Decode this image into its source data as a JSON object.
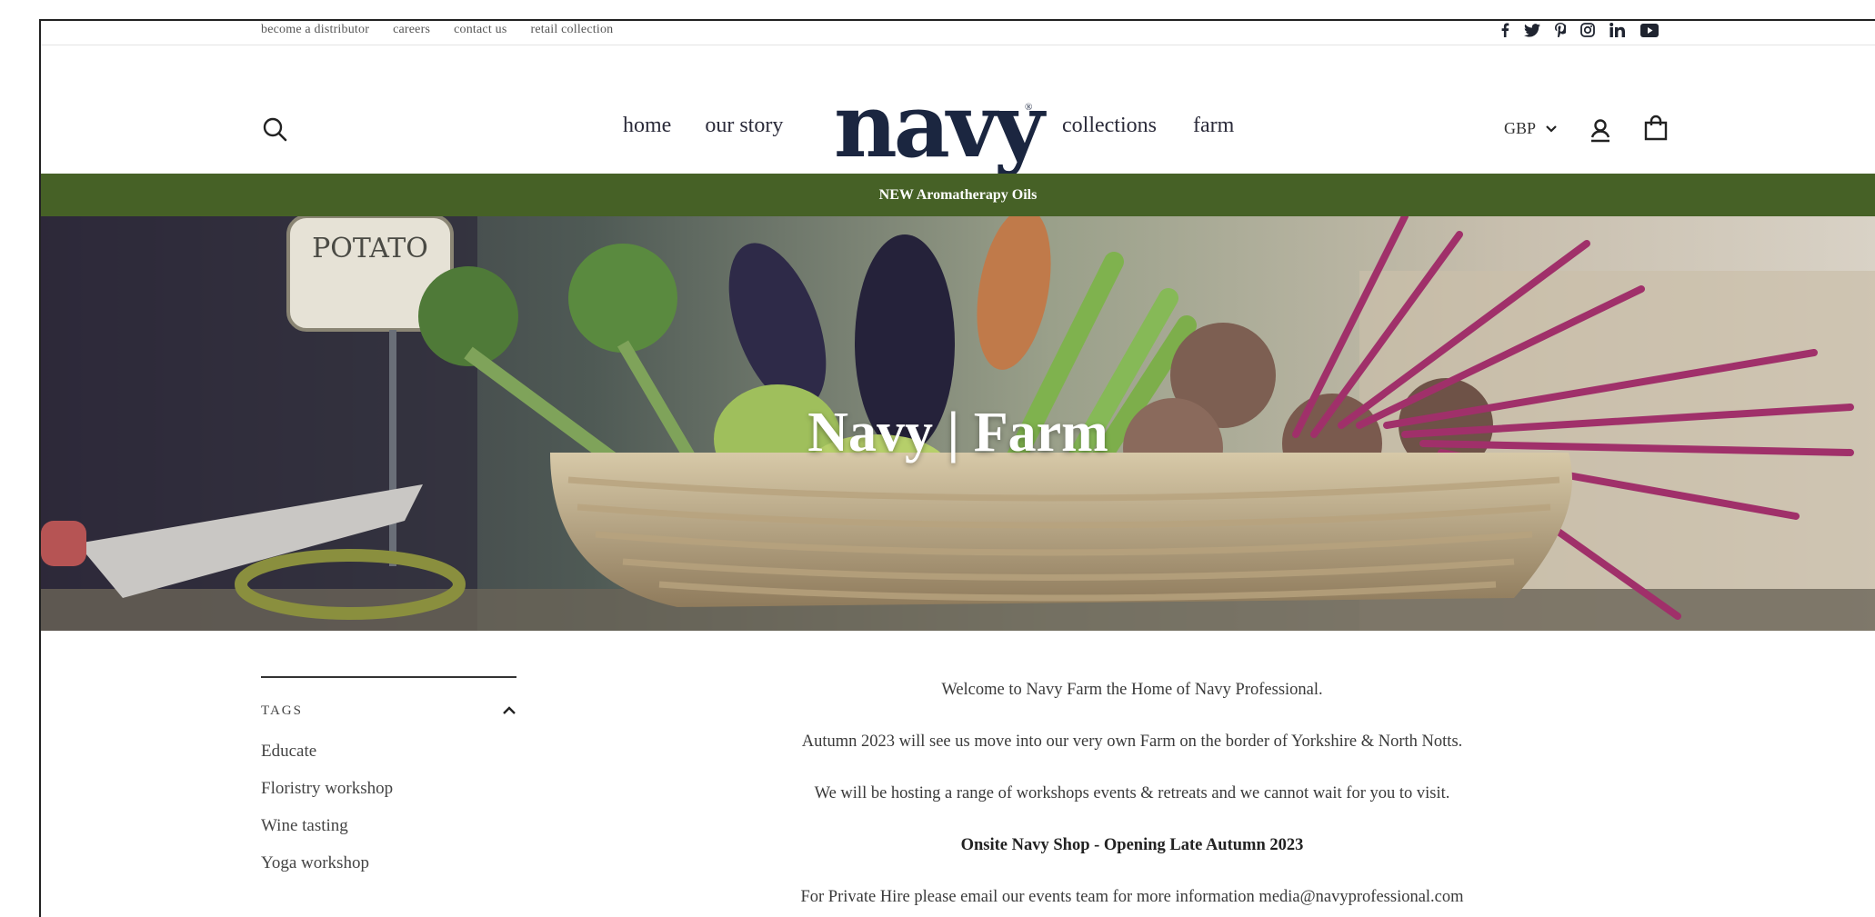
{
  "utility_bar": {
    "links": [
      "become a distributor",
      "careers",
      "contact us",
      "retail collection"
    ],
    "social_icons": [
      "facebook-icon",
      "twitter-icon",
      "pinterest-icon",
      "instagram-icon",
      "linkedin-icon",
      "youtube-icon"
    ]
  },
  "header": {
    "nav_left": [
      "home",
      "our story"
    ],
    "logo": "navy",
    "logo_mark": "®",
    "nav_right": [
      "collections",
      "farm"
    ],
    "currency": "GBP"
  },
  "announcement": "NEW Aromatherapy Oils",
  "hero": {
    "title": "Navy | Farm",
    "sign_text": "POTATO"
  },
  "sidebar": {
    "tags_title": "TAGS",
    "tags": [
      "Educate",
      "Floristry workshop",
      "Wine tasting",
      "Yoga workshop"
    ]
  },
  "content": {
    "paragraphs": [
      "Welcome to Navy Farm the Home of Navy Professional.",
      "Autumn 2023 will see us move into our very own Farm on the border of Yorkshire & North Notts.",
      "We will be hosting a range of workshops events & retreats and we cannot wait for you to visit."
    ],
    "shop_notice": "Onsite Navy Shop - Opening Late Autumn 2023",
    "private_hire": "For Private Hire please email our events team for more information media@navyprofessional.com"
  },
  "colors": {
    "announcement_bg": "#466126",
    "logo": "#1b2640"
  }
}
